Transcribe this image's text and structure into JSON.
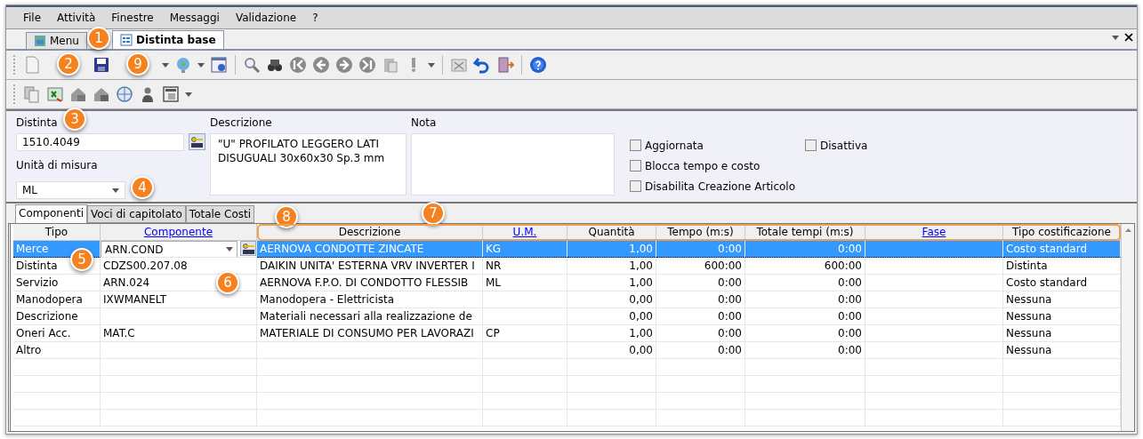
{
  "menu": [
    "File",
    "Attività",
    "Finestre",
    "Messaggi",
    "Validazione",
    "?"
  ],
  "doc_tabs": [
    {
      "label": "Menu",
      "selected": false
    },
    {
      "label": "Distinta base",
      "selected": true
    }
  ],
  "form": {
    "distinta": {
      "label": "Distinta",
      "value": "1510.4049"
    },
    "unita": {
      "label": "Unità di misura",
      "value": "ML"
    },
    "descrizione": {
      "label": "Descrizione",
      "value": "\"U\" PROFILATO LEGGERO LATI DISUGUALI 30x60x30 Sp.3 mm"
    },
    "nota": {
      "label": "Nota"
    },
    "checks": [
      {
        "label": "Aggiornata",
        "checked": false
      },
      {
        "label": "Blocca tempo e costo",
        "checked": false
      },
      {
        "label": "Disabilita Creazione Articolo",
        "checked": false
      },
      {
        "label": "Disattiva",
        "checked": false
      }
    ]
  },
  "tabs": [
    {
      "label": "Componenti",
      "selected": true
    },
    {
      "label": "Voci di capitolato",
      "selected": false
    },
    {
      "label": "Totale Costi",
      "selected": false
    }
  ],
  "table": {
    "columns": [
      {
        "label": "Tipo",
        "link": false,
        "numeric": false
      },
      {
        "label": "Componente",
        "link": true,
        "numeric": false
      },
      {
        "label": "Descrizione",
        "link": false,
        "numeric": false
      },
      {
        "label": "U.M.",
        "link": true,
        "numeric": false
      },
      {
        "label": "Quantità",
        "link": false,
        "numeric": true
      },
      {
        "label": "Tempo (m:s)",
        "link": false,
        "numeric": true
      },
      {
        "label": "Totale tempi (m:s)",
        "link": false,
        "numeric": true
      },
      {
        "label": "Fase",
        "link": true
      },
      {
        "label": "Tipo costificazione",
        "link": false,
        "numeric": false
      }
    ],
    "rows": [
      {
        "selected": true,
        "cells": [
          "Merce",
          "ARN.COND",
          "AERNOVA CONDOTTE ZINCATE",
          "KG",
          "1,00",
          "0:00",
          "0:00",
          null,
          "Costo standard"
        ]
      },
      {
        "selected": false,
        "cells": [
          "Distinta",
          "CDZS00.207.08",
          "DAIKIN UNITA' ESTERNA VRV INVERTER I",
          "NR",
          "1,00",
          "600:00",
          "600:00",
          null,
          "Distinta"
        ]
      },
      {
        "selected": false,
        "cells": [
          "Servizio",
          "ARN.024",
          "AERNOVA F.P.O. DI CONDOTTO FLESSIB",
          "ML",
          "1,00",
          "0:00",
          "0:00",
          null,
          "Costo standard"
        ]
      },
      {
        "selected": false,
        "cells": [
          "Manodopera",
          "IXWMANELT",
          "Manodopera - Elettricista",
          null,
          "0,00",
          "0:00",
          "0:00",
          null,
          "Nessuna"
        ]
      },
      {
        "selected": false,
        "cells": [
          "Descrizione",
          null,
          "Materiali necessari alla realizzazione de",
          null,
          "0,00",
          "0:00",
          "0:00",
          null,
          "Nessuna"
        ]
      },
      {
        "selected": false,
        "cells": [
          "Oneri Acc.",
          "MAT.C",
          "MATERIALE DI CONSUMO PER LAVORAZI",
          "CP",
          "1,00",
          "0:00",
          "0:00",
          null,
          "Nessuna"
        ]
      },
      {
        "selected": false,
        "cells": [
          "Altro",
          null,
          null,
          null,
          "0,00",
          "0:00",
          "0:00",
          null,
          "Nessuna"
        ]
      }
    ]
  },
  "callouts": [
    "1",
    "2",
    "9",
    "3",
    "4",
    "8",
    "7",
    "5",
    "6"
  ]
}
